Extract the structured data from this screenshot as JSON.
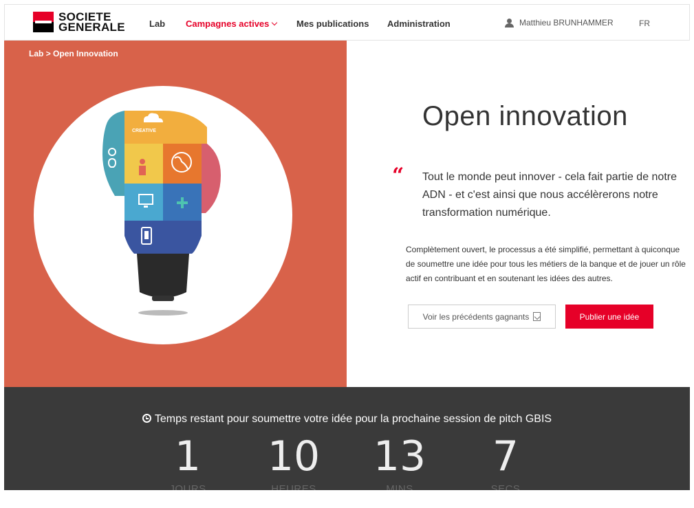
{
  "brand": {
    "name_line1": "SOCIETE",
    "name_line2": "GENERALE",
    "red": "#e60028",
    "black": "#000000"
  },
  "nav": {
    "lab": "Lab",
    "campagnes": "Campagnes actives",
    "publications": "Mes publications",
    "administration": "Administration",
    "user": "Matthieu BRUNHAMMER",
    "lang": "FR"
  },
  "breadcrumb": {
    "root": "Lab",
    "separator": ">",
    "current": "Open Innovation"
  },
  "hero": {
    "bg_color": "#d8624a",
    "illustration_label": "CREATIVE",
    "title": "Open innovation",
    "quote": "Tout le monde peut innover - cela fait partie de notre ADN - et c'est ainsi que nous accélèrerons notre transformation numérique.",
    "description": "Complètement ouvert, le processus a été simplifié, permettant à quiconque de soumettre une idée pour tous les métiers de la banque et de jouer un rôle actif en contribuant et en soutenant les idées des autres.",
    "btn_winners": "Voir les précédents gagnants",
    "btn_publish": "Publier une idée"
  },
  "countdown": {
    "title": "Temps restant pour soumettre votre idée pour la prochaine session de pitch GBIS",
    "days": "1",
    "days_label": "JOURS",
    "hours": "10",
    "hours_label": "HEURES",
    "mins": "13",
    "mins_label": "MINS",
    "secs": "7",
    "secs_label": "SECS"
  }
}
